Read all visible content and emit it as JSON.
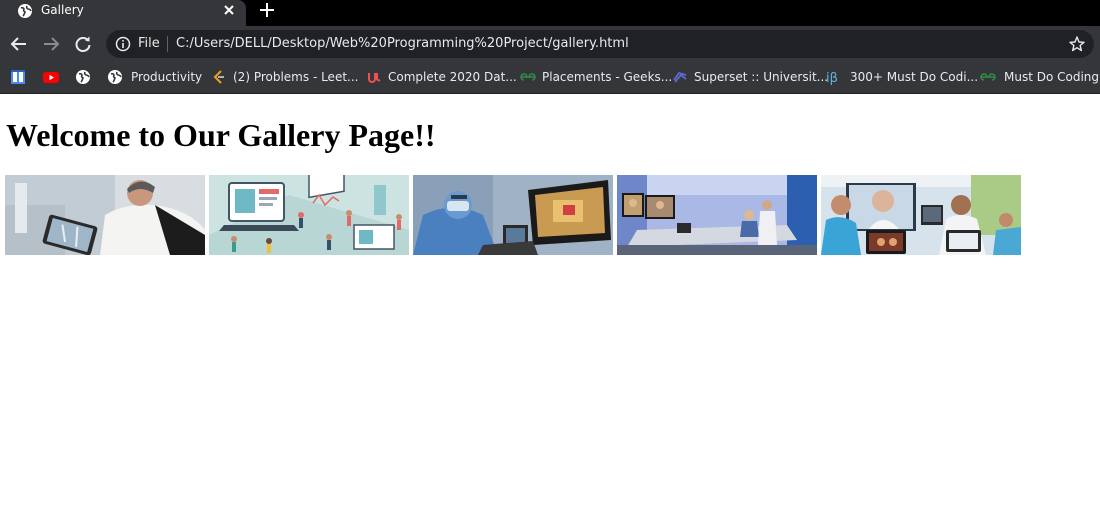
{
  "tab": {
    "title": "Gallery",
    "close_icon": "close-icon",
    "new_tab_icon": "plus-icon"
  },
  "toolbar": {
    "back_icon": "arrow-left-icon",
    "forward_icon": "arrow-right-icon",
    "reload_icon": "reload-icon",
    "scheme_label": "File",
    "url": "C:/Users/DELL/Desktop/Web%20Programming%20Project/gallery.html",
    "bookmark_star_icon": "star-icon"
  },
  "bookmarks": [
    {
      "label": "",
      "icon": "apps-icon"
    },
    {
      "label": "",
      "icon": "youtube-icon"
    },
    {
      "label": "",
      "icon": "globe-icon"
    },
    {
      "label": "Productivity",
      "icon": "globe-icon"
    },
    {
      "label": "(2) Problems - Leet...",
      "icon": "leetcode-icon"
    },
    {
      "label": "Complete 2020 Dat...",
      "icon": "udemy-icon"
    },
    {
      "label": "Placements - Geeks...",
      "icon": "geeksforgeeks-icon"
    },
    {
      "label": "Superset :: Universit...",
      "icon": "superset-icon"
    },
    {
      "label": "300+ Must Do Codi...",
      "icon": "interviewbit-icon"
    },
    {
      "label": "Must Do Coding Q",
      "icon": "geeksforgeeks-icon"
    }
  ],
  "page": {
    "heading": "Welcome to Our Gallery Page!!",
    "images": [
      {
        "subject": "doctor with tablet showing x-ray"
      },
      {
        "subject": "digital healthcare illustration"
      },
      {
        "subject": "surgeon at monitor"
      },
      {
        "subject": "telemedicine video conference room"
      },
      {
        "subject": "medical team at laptop video call"
      }
    ]
  },
  "colors": {
    "tab_bar": "#000000",
    "toolbar": "#35363a",
    "omnibox": "#202124",
    "text": "#e8eaed"
  }
}
